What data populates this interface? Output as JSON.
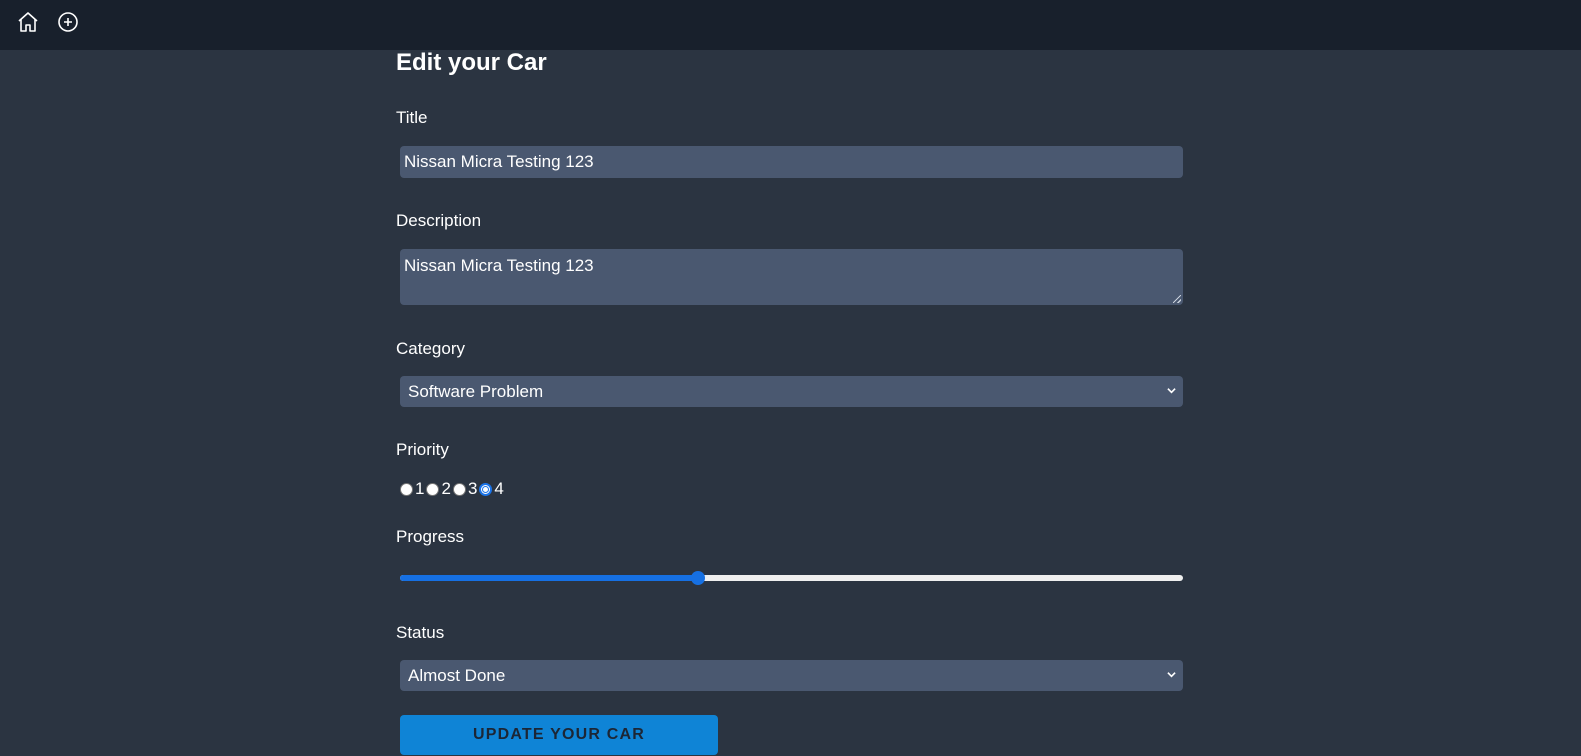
{
  "nav": {
    "home_icon": "home-icon",
    "add_icon": "plus-circle-icon"
  },
  "form": {
    "heading": "Edit your Car",
    "title_label": "Title",
    "title_value": "Nissan Micra Testing 123",
    "description_label": "Description",
    "description_value": "Nissan Micra Testing 123",
    "category_label": "Category",
    "category_selected": "Software Problem",
    "priority_label": "Priority",
    "priority_options": [
      "1",
      "2",
      "3",
      "4"
    ],
    "priority_selected": "4",
    "progress_label": "Progress",
    "progress_value": 0.38,
    "status_label": "Status",
    "status_selected": "Almost Done",
    "submit_label": "UPDATE YOUR CAR"
  },
  "colors": {
    "page_bg": "#2b3441",
    "topbar_bg": "#18202c",
    "input_bg": "#4a5870",
    "accent": "#1670e3",
    "button_bg": "#0f84d6"
  }
}
